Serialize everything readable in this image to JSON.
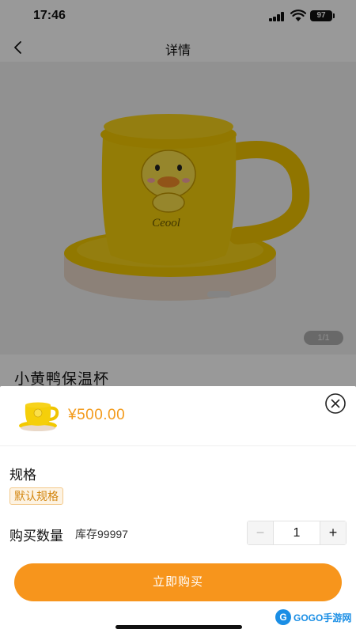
{
  "status_bar": {
    "time": "17:46",
    "battery": "97"
  },
  "nav": {
    "title": "详情"
  },
  "product": {
    "name": "小黄鸭保温杯",
    "image_pager": "1/1",
    "cup_brand": "Ceool"
  },
  "sheet": {
    "price": "¥500.00",
    "spec_label": "规格",
    "spec_option": "默认规格",
    "quantity_label": "购买数量",
    "stock_text": "库存99997",
    "quantity_value": "1",
    "minus_symbol": "−",
    "plus_symbol": "+",
    "buy_button": "立即购买"
  },
  "watermark": {
    "badge": "G",
    "text": "GOGO手游网"
  },
  "colors": {
    "accent": "#f7951c",
    "price": "#f39b1c",
    "chip_border": "#f3c98b",
    "chip_bg": "#fdf3e3"
  }
}
